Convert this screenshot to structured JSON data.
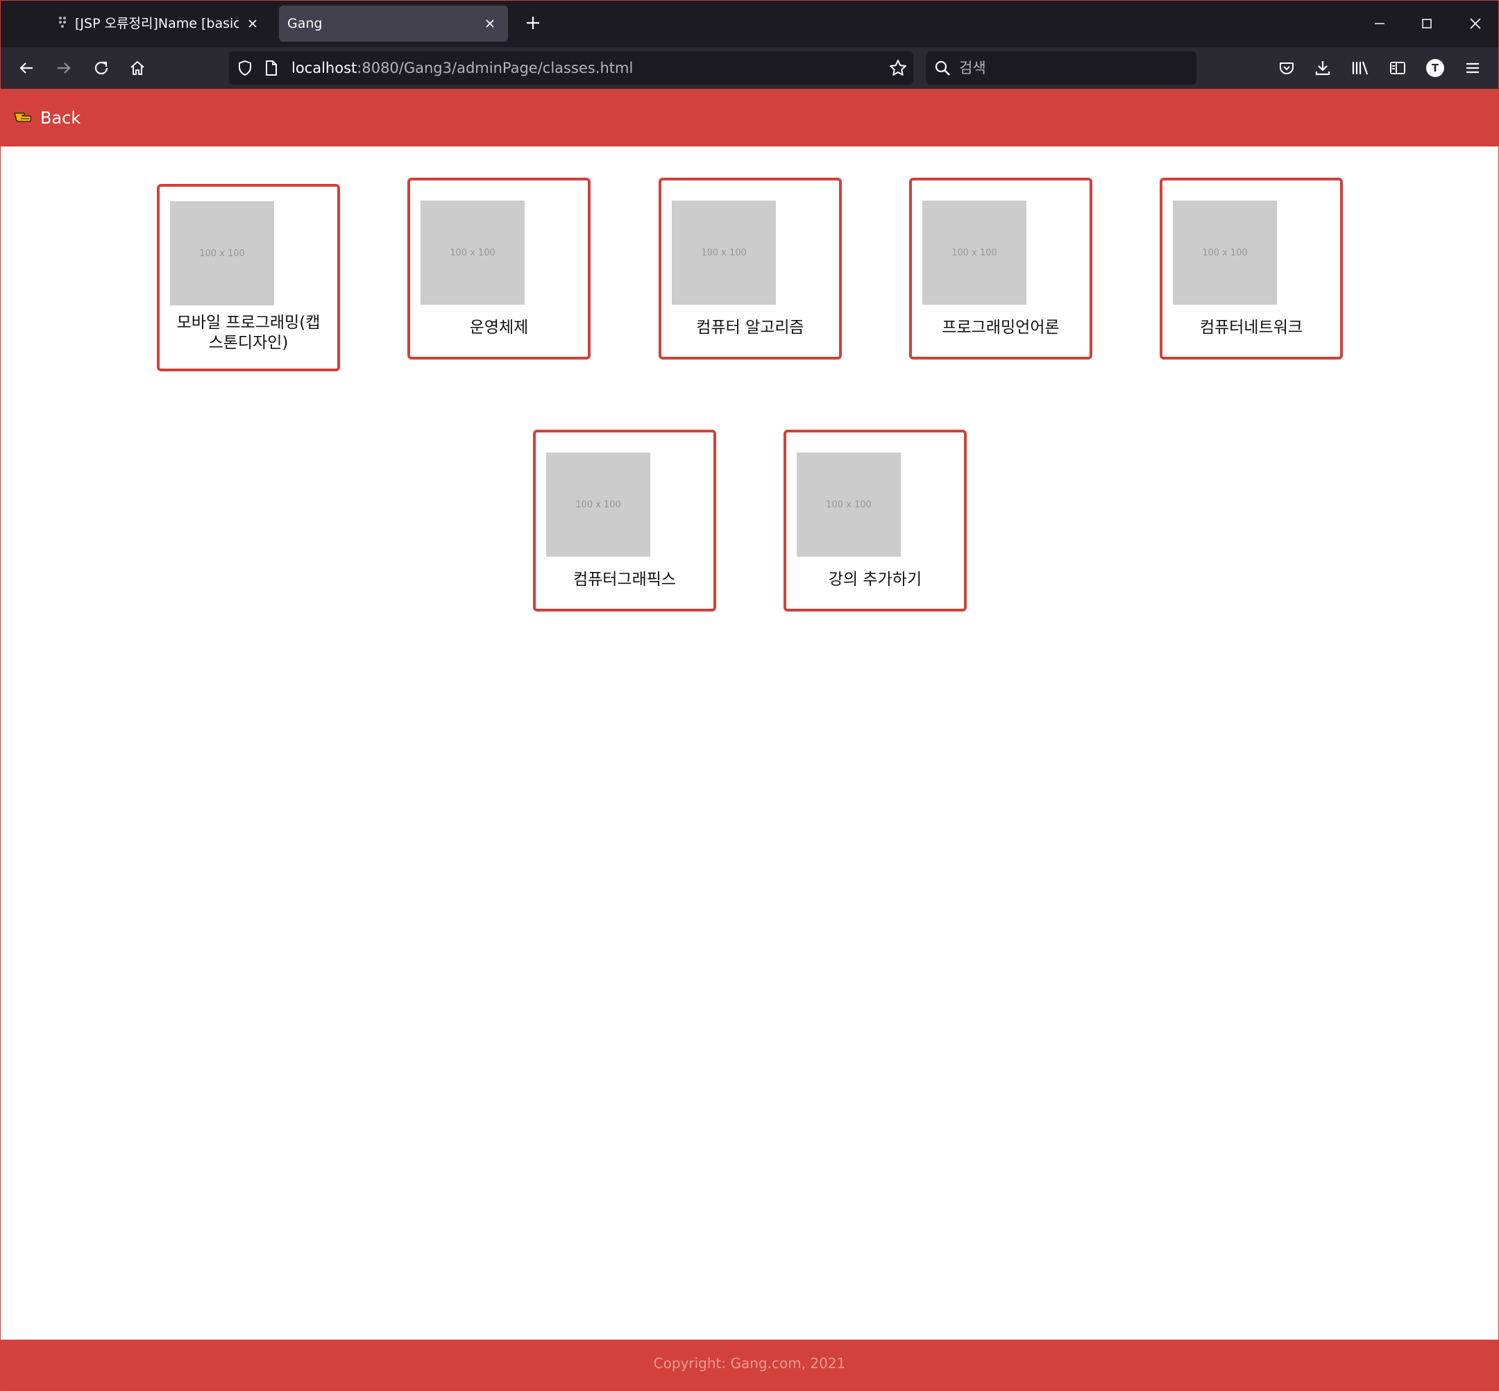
{
  "browser": {
    "tabs": [
      {
        "title": "[JSP 오류정리]Name [basicjsp] i",
        "active": false
      },
      {
        "title": "Gang",
        "active": true
      }
    ],
    "url": {
      "host": "localhost",
      "rest": ":8080/Gang3/adminPage/classes.html"
    },
    "search_placeholder": "검색",
    "profile_initial": "T"
  },
  "header": {
    "back_label": "Back"
  },
  "courses": [
    {
      "thumb_text": "100 x 100",
      "label": "모바일 프로그래밍(캡스톤디자인)"
    },
    {
      "thumb_text": "100 x 100",
      "label": "운영체제"
    },
    {
      "thumb_text": "100 x 100",
      "label": "컴퓨터 알고리즘"
    },
    {
      "thumb_text": "100 x 100",
      "label": "프로그래밍언어론"
    },
    {
      "thumb_text": "100 x 100",
      "label": "컴퓨터네트워크"
    },
    {
      "thumb_text": "100 x 100",
      "label": "컴퓨터그래픽스"
    },
    {
      "thumb_text": "100 x 100",
      "label": "강의 추가하기"
    }
  ],
  "footer": {
    "copyright": "Copyright: Gang.com, 2021"
  },
  "colors": {
    "accent": "#d2413b",
    "tabbar": "#1c1b22",
    "toolbar": "#2b2a33"
  }
}
